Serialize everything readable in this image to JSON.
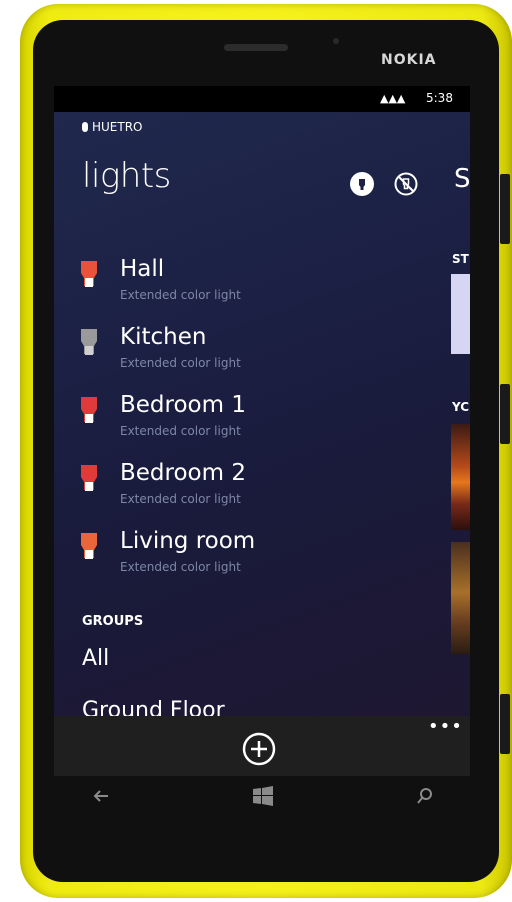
{
  "device": {
    "brand": "NOKIA"
  },
  "status_bar": {
    "signal": "▲▲▲",
    "time": "5:38"
  },
  "app": {
    "name": "HUETRO"
  },
  "page": {
    "title": "lights"
  },
  "next_panel": {
    "title": "S",
    "section_1": "ST",
    "section_2": "YC"
  },
  "lights": [
    {
      "name": "Hall",
      "type": "Extended color light",
      "bulb_color": "#e8533a"
    },
    {
      "name": "Kitchen",
      "type": "Extended color light",
      "bulb_color": "#9a9a9a"
    },
    {
      "name": "Bedroom 1",
      "type": "Extended color light",
      "bulb_color": "#e03a3a"
    },
    {
      "name": "Bedroom 2",
      "type": "Extended color light",
      "bulb_color": "#e03a3a"
    },
    {
      "name": "Living room",
      "type": "Extended color light",
      "bulb_color": "#e8663a"
    }
  ],
  "groups": {
    "header": "GROUPS",
    "items": [
      "All",
      "Ground Floor"
    ]
  },
  "app_bar": {
    "more": "•••"
  },
  "colors": {
    "accent": "#ffffff",
    "background": "#1b2044",
    "secondary_text": "#7e87a6",
    "shell": "#f2ee18"
  }
}
